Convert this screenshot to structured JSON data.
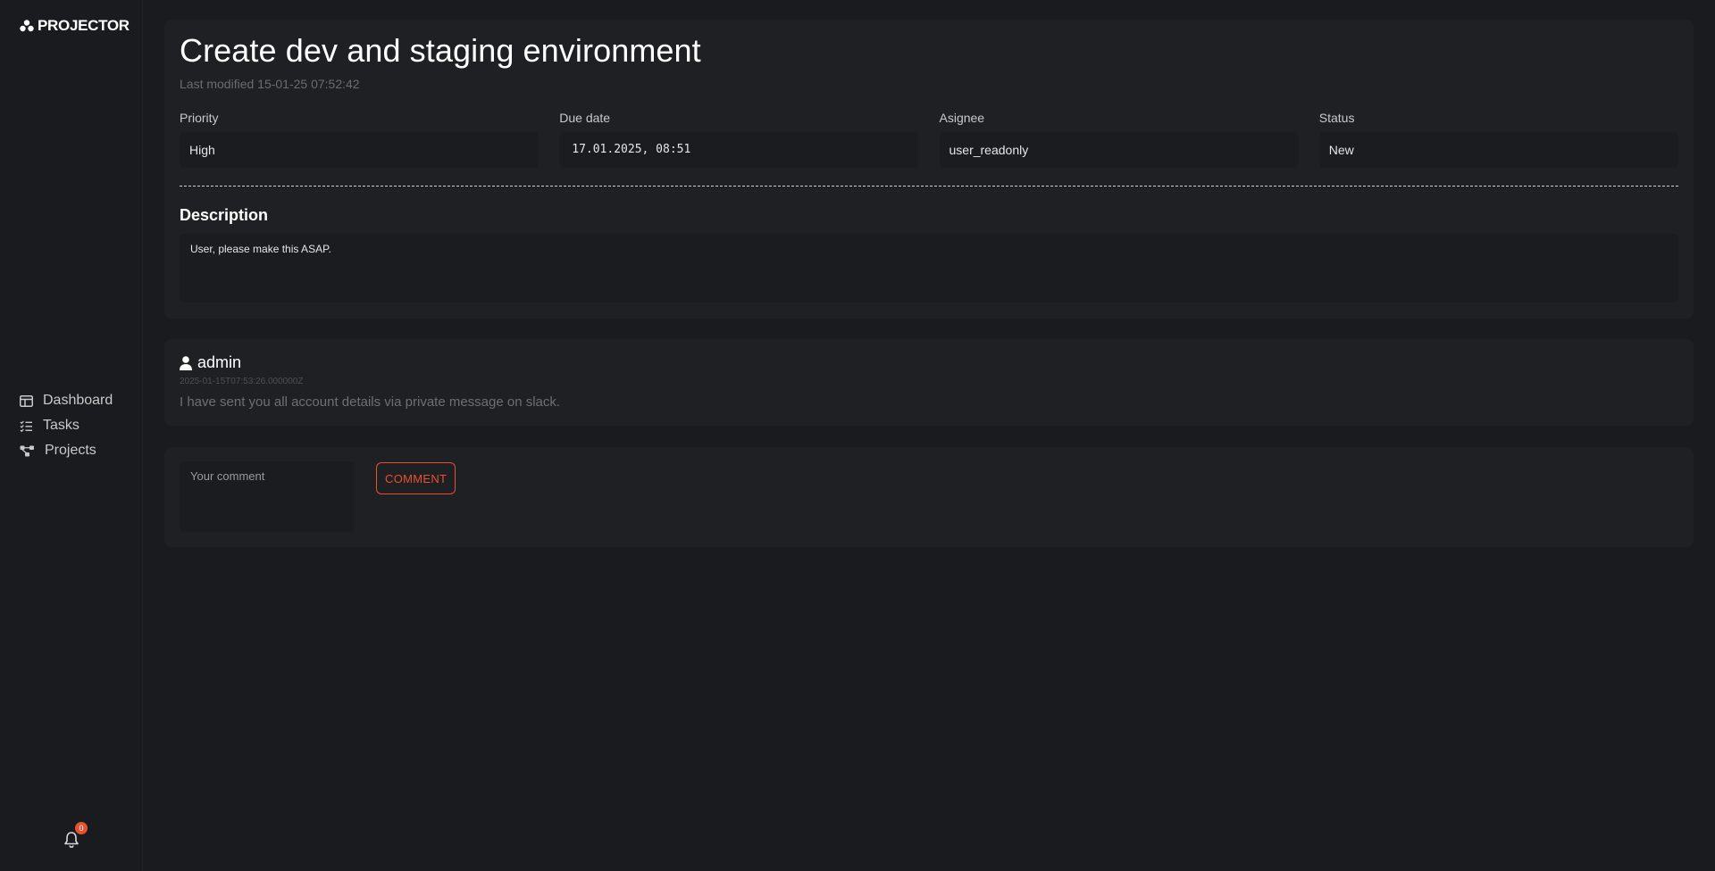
{
  "app": {
    "name": "PROJECTOR",
    "accent_color": "#e8512f"
  },
  "sidebar": {
    "items": [
      {
        "label": "Dashboard",
        "icon": "dashboard-icon"
      },
      {
        "label": "Tasks",
        "icon": "tasks-icon"
      },
      {
        "label": "Projects",
        "icon": "projects-icon"
      }
    ],
    "notifications": {
      "icon": "bell-icon",
      "count": "0"
    }
  },
  "task": {
    "title": "Create dev and staging environment",
    "last_modified": "Last modified 15-01-25 07:52:42",
    "fields": {
      "priority": {
        "label": "Priority",
        "value": "High"
      },
      "due_date": {
        "label": "Due date",
        "value": "17.01.2025, 08:51"
      },
      "assignee": {
        "label": "Asignee",
        "value": "user_readonly"
      },
      "status": {
        "label": "Status",
        "value": "New"
      }
    },
    "description_heading": "Description",
    "description": "User, please make this ASAP."
  },
  "comments": [
    {
      "author": "admin",
      "timestamp": "2025-01-15T07:53:26.000000Z",
      "text": "I have sent you all account details via private message on slack."
    }
  ],
  "new_comment": {
    "placeholder": "Your comment",
    "button_label": "COMMENT"
  }
}
